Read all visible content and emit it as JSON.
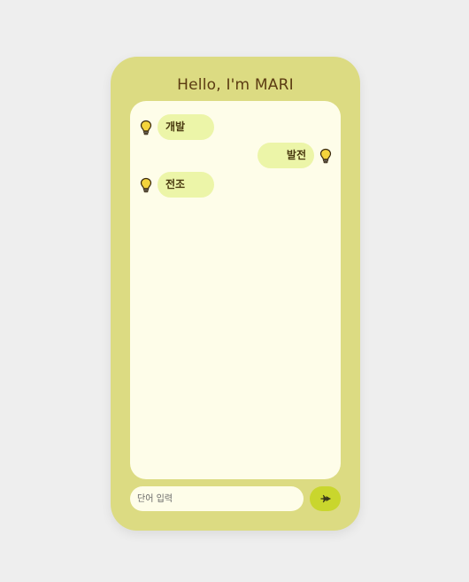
{
  "header": {
    "title": "Hello, I'm MARI"
  },
  "messages": [
    {
      "side": "left",
      "text": "개발",
      "icon": "lightbulb-icon"
    },
    {
      "side": "right",
      "text": "발전",
      "icon": "lightbulb-icon"
    },
    {
      "side": "left",
      "text": "전조",
      "icon": "lightbulb-icon"
    }
  ],
  "input": {
    "placeholder": "단어 입력",
    "value": ""
  },
  "send_button": {
    "icon": "send-icon"
  },
  "colors": {
    "page_background": "#eeeeee",
    "phone_background": "#dcdb82",
    "chat_background": "#fefde9",
    "bubble": "#ecf5a8",
    "send_button": "#c9d62d",
    "title_text": "#5b3b12"
  }
}
